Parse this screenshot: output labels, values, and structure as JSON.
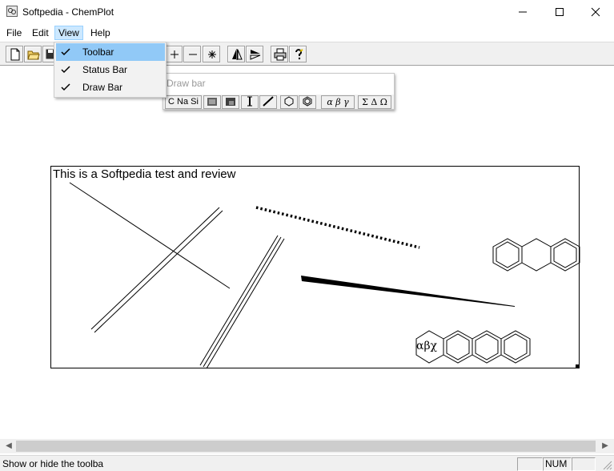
{
  "window": {
    "title": "Softpedia - ChemPlot"
  },
  "menu": {
    "file": "File",
    "edit": "Edit",
    "view": "View",
    "help": "Help"
  },
  "view_menu": {
    "items": [
      {
        "label": "Toolbar",
        "checked": true
      },
      {
        "label": "Status Bar",
        "checked": true
      },
      {
        "label": "Draw Bar",
        "checked": true
      }
    ]
  },
  "toolbar": {
    "icons": [
      "new-file-icon",
      "open-folder-icon",
      "save-icon",
      "zoom-in-icon",
      "zoom-out-icon",
      "asterisk-icon",
      "flip-horizontal-icon",
      "flip-vertical-icon",
      "print-icon",
      "help-icon"
    ],
    "zoom_in": "+",
    "zoom_out": "−",
    "asterisk": "✳"
  },
  "drawbar": {
    "title": "Draw bar",
    "elements": "C Na Si",
    "greek_lower": "α β γ",
    "greek_upper": "Σ Δ Ω"
  },
  "canvas": {
    "text": "This is a Softpedia test and review",
    "greek_label": "αβχ"
  },
  "status": {
    "message": "Show or hide the toolba",
    "num": "NUM"
  },
  "colors": {
    "menu_highlight": "#91c9f7",
    "menu_bg": "#f2f2f2",
    "toolbar_bg": "#f0f0f0"
  }
}
